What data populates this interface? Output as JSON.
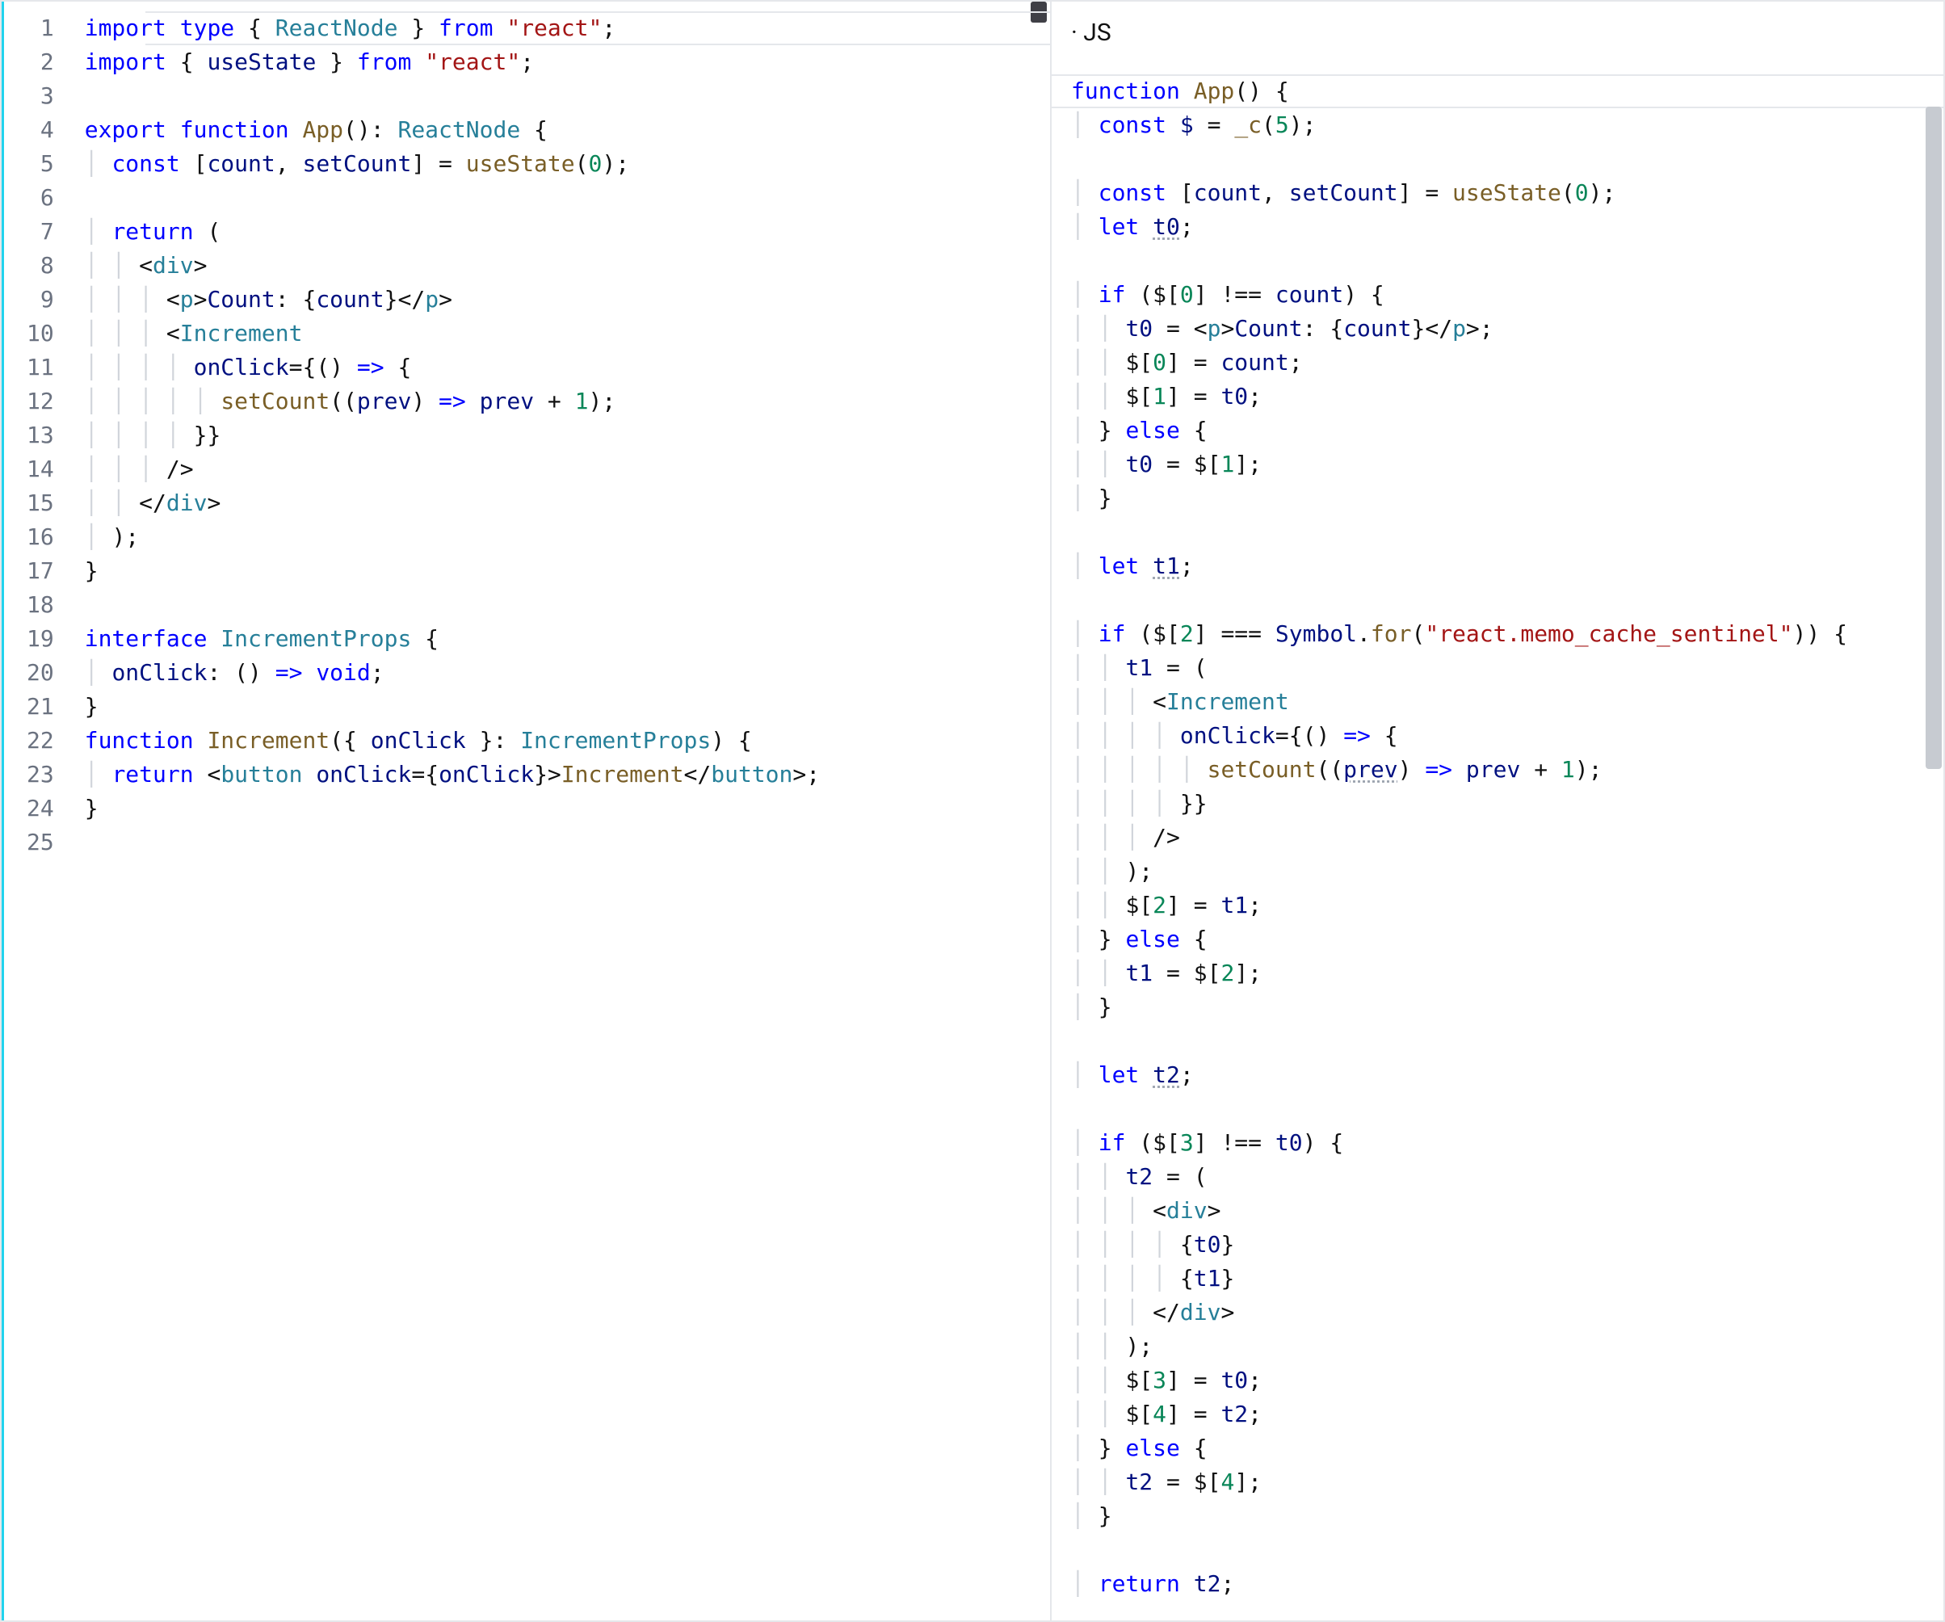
{
  "header": {
    "right_label": "· JS"
  },
  "left": {
    "lineStart": 1,
    "lines": [
      [
        [
          "kw",
          "import"
        ],
        [
          "",
          " "
        ],
        [
          "kw",
          "type"
        ],
        [
          "",
          " { "
        ],
        [
          "type",
          "ReactNode"
        ],
        [
          "",
          " } "
        ],
        [
          "kw",
          "from"
        ],
        [
          "",
          " "
        ],
        [
          "str",
          "\"react\""
        ],
        [
          "",
          ";"
        ]
      ],
      [
        [
          "kw",
          "import"
        ],
        [
          "",
          " { "
        ],
        [
          "var",
          "useState"
        ],
        [
          "",
          " } "
        ],
        [
          "kw",
          "from"
        ],
        [
          "",
          " "
        ],
        [
          "str",
          "\"react\""
        ],
        [
          "",
          ";"
        ]
      ],
      [],
      [
        [
          "kw",
          "export"
        ],
        [
          "",
          " "
        ],
        [
          "kw",
          "function"
        ],
        [
          "",
          " "
        ],
        [
          "fn",
          "App"
        ],
        [
          "",
          "(): "
        ],
        [
          "type",
          "ReactNode"
        ],
        [
          "",
          " {"
        ]
      ],
      [
        [
          "",
          "  "
        ],
        [
          "kw",
          "const"
        ],
        [
          "",
          " ["
        ],
        [
          "var",
          "count"
        ],
        [
          "",
          ", "
        ],
        [
          "var",
          "setCount"
        ],
        [
          "",
          "] = "
        ],
        [
          "fn",
          "useState"
        ],
        [
          "",
          "("
        ],
        [
          "num",
          "0"
        ],
        [
          "",
          ");"
        ]
      ],
      [],
      [
        [
          "",
          "  "
        ],
        [
          "kw",
          "return"
        ],
        [
          "",
          " ("
        ]
      ],
      [
        [
          "",
          "    <"
        ],
        [
          "tag",
          "div"
        ],
        [
          "",
          ">"
        ]
      ],
      [
        [
          "",
          "      <"
        ],
        [
          "tag",
          "p"
        ],
        [
          "",
          ">"
        ],
        [
          "var",
          "Count"
        ],
        [
          "",
          ": {"
        ],
        [
          "var",
          "count"
        ],
        [
          "",
          "}</"
        ],
        [
          "tag",
          "p"
        ],
        [
          "",
          ">"
        ]
      ],
      [
        [
          "",
          "      <"
        ],
        [
          "tag",
          "Increment"
        ]
      ],
      [
        [
          "",
          "        "
        ],
        [
          "var",
          "onClick"
        ],
        [
          "",
          "={() "
        ],
        [
          "kw",
          "=>"
        ],
        [
          "",
          " {"
        ]
      ],
      [
        [
          "",
          "          "
        ],
        [
          "fn",
          "setCount"
        ],
        [
          "",
          "(("
        ],
        [
          "var",
          "prev"
        ],
        [
          "",
          ") "
        ],
        [
          "kw",
          "=>"
        ],
        [
          "",
          " "
        ],
        [
          "var",
          "prev"
        ],
        [
          "",
          " + "
        ],
        [
          "num",
          "1"
        ],
        [
          "",
          ");"
        ]
      ],
      [
        [
          "",
          "        }}"
        ]
      ],
      [
        [
          "",
          "      />"
        ]
      ],
      [
        [
          "",
          "    </"
        ],
        [
          "tag",
          "div"
        ],
        [
          "",
          ">"
        ]
      ],
      [
        [
          "",
          "  );"
        ]
      ],
      [
        [
          "",
          "}"
        ]
      ],
      [],
      [
        [
          "kw",
          "interface"
        ],
        [
          "",
          " "
        ],
        [
          "type",
          "IncrementProps"
        ],
        [
          "",
          " {"
        ]
      ],
      [
        [
          "",
          "  "
        ],
        [
          "var",
          "onClick"
        ],
        [
          "",
          ": () "
        ],
        [
          "kw",
          "=>"
        ],
        [
          "",
          " "
        ],
        [
          "kw",
          "void"
        ],
        [
          "",
          ";"
        ]
      ],
      [
        [
          "",
          "}"
        ]
      ],
      [
        [
          "kw",
          "function"
        ],
        [
          "",
          " "
        ],
        [
          "fn",
          "Increment"
        ],
        [
          "",
          "({ "
        ],
        [
          "var",
          "onClick"
        ],
        [
          "",
          " }: "
        ],
        [
          "type",
          "IncrementProps"
        ],
        [
          "",
          ") {"
        ]
      ],
      [
        [
          "",
          "  "
        ],
        [
          "kw",
          "return"
        ],
        [
          "",
          " <"
        ],
        [
          "tag",
          "button"
        ],
        [
          "",
          " "
        ],
        [
          "var",
          "onClick"
        ],
        [
          "",
          "={"
        ],
        [
          "var",
          "onClick"
        ],
        [
          "",
          "}>"
        ],
        [
          "fn",
          "Increment"
        ],
        [
          "",
          "</"
        ],
        [
          "tag",
          "button"
        ],
        [
          "",
          ">;"
        ]
      ],
      [
        [
          "",
          "}"
        ]
      ],
      []
    ]
  },
  "right": {
    "lines": [
      [
        [
          "kw",
          "function"
        ],
        [
          "",
          " "
        ],
        [
          "fn",
          "App"
        ],
        [
          "",
          "() {"
        ]
      ],
      [
        [
          "",
          "  "
        ],
        [
          "kw",
          "const"
        ],
        [
          "",
          " "
        ],
        [
          "var",
          "$"
        ],
        [
          "",
          " = "
        ],
        [
          "fn",
          "_c"
        ],
        [
          "",
          "("
        ],
        [
          "num",
          "5"
        ],
        [
          "",
          ");"
        ]
      ],
      [],
      [
        [
          "",
          "  "
        ],
        [
          "kw",
          "const"
        ],
        [
          "",
          " ["
        ],
        [
          "var",
          "count"
        ],
        [
          "",
          ", "
        ],
        [
          "var",
          "setCount"
        ],
        [
          "",
          "] = "
        ],
        [
          "fn",
          "useState"
        ],
        [
          "",
          "("
        ],
        [
          "num",
          "0"
        ],
        [
          "",
          ");"
        ]
      ],
      [
        [
          "",
          "  "
        ],
        [
          "kw",
          "let"
        ],
        [
          "",
          " "
        ],
        [
          "var ul",
          "t0"
        ],
        [
          "",
          ";"
        ]
      ],
      [],
      [
        [
          "",
          "  "
        ],
        [
          "kw",
          "if"
        ],
        [
          "",
          " ($["
        ],
        [
          "num",
          "0"
        ],
        [
          "",
          "] !== "
        ],
        [
          "var",
          "count"
        ],
        [
          "",
          ") {"
        ]
      ],
      [
        [
          "",
          "    "
        ],
        [
          "var",
          "t0"
        ],
        [
          "",
          " = <"
        ],
        [
          "tag",
          "p"
        ],
        [
          "",
          ">"
        ],
        [
          "var",
          "Count"
        ],
        [
          "",
          ": {"
        ],
        [
          "var",
          "count"
        ],
        [
          "",
          "}</"
        ],
        [
          "tag",
          "p"
        ],
        [
          "",
          ">;"
        ]
      ],
      [
        [
          "",
          "    $["
        ],
        [
          "num",
          "0"
        ],
        [
          "",
          "] = "
        ],
        [
          "var",
          "count"
        ],
        [
          "",
          ";"
        ]
      ],
      [
        [
          "",
          "    $["
        ],
        [
          "num",
          "1"
        ],
        [
          "",
          "] = "
        ],
        [
          "var",
          "t0"
        ],
        [
          "",
          ";"
        ]
      ],
      [
        [
          "",
          "  } "
        ],
        [
          "kw",
          "else"
        ],
        [
          "",
          " {"
        ]
      ],
      [
        [
          "",
          "    "
        ],
        [
          "var",
          "t0"
        ],
        [
          "",
          " = $["
        ],
        [
          "num",
          "1"
        ],
        [
          "",
          "];"
        ]
      ],
      [
        [
          "",
          "  }"
        ]
      ],
      [],
      [
        [
          "",
          "  "
        ],
        [
          "kw",
          "let"
        ],
        [
          "",
          " "
        ],
        [
          "var ul",
          "t1"
        ],
        [
          "",
          ";"
        ]
      ],
      [],
      [
        [
          "",
          "  "
        ],
        [
          "kw",
          "if"
        ],
        [
          "",
          " ($["
        ],
        [
          "num",
          "2"
        ],
        [
          "",
          "] === "
        ],
        [
          "var",
          "Symbol"
        ],
        [
          "",
          "."
        ],
        [
          "fn",
          "for"
        ],
        [
          "",
          "("
        ],
        [
          "str",
          "\"react.memo_cache_sentinel\""
        ],
        [
          "",
          ")) {"
        ]
      ],
      [
        [
          "",
          "    "
        ],
        [
          "var",
          "t1"
        ],
        [
          "",
          " = ("
        ]
      ],
      [
        [
          "",
          "      <"
        ],
        [
          "tag",
          "Increment"
        ]
      ],
      [
        [
          "",
          "        "
        ],
        [
          "var",
          "onClick"
        ],
        [
          "",
          "={() "
        ],
        [
          "kw",
          "=>"
        ],
        [
          "",
          " {"
        ]
      ],
      [
        [
          "",
          "          "
        ],
        [
          "fn",
          "setCount"
        ],
        [
          "",
          "(("
        ],
        [
          "var ul",
          "prev"
        ],
        [
          "",
          ") "
        ],
        [
          "kw",
          "=>"
        ],
        [
          "",
          " "
        ],
        [
          "var",
          "prev"
        ],
        [
          "",
          " + "
        ],
        [
          "num",
          "1"
        ],
        [
          "",
          ");"
        ]
      ],
      [
        [
          "",
          "        }}"
        ]
      ],
      [
        [
          "",
          "      />"
        ]
      ],
      [
        [
          "",
          "    );"
        ]
      ],
      [
        [
          "",
          "    $["
        ],
        [
          "num",
          "2"
        ],
        [
          "",
          "] = "
        ],
        [
          "var",
          "t1"
        ],
        [
          "",
          ";"
        ]
      ],
      [
        [
          "",
          "  } "
        ],
        [
          "kw",
          "else"
        ],
        [
          "",
          " {"
        ]
      ],
      [
        [
          "",
          "    "
        ],
        [
          "var",
          "t1"
        ],
        [
          "",
          " = $["
        ],
        [
          "num",
          "2"
        ],
        [
          "",
          "];"
        ]
      ],
      [
        [
          "",
          "  }"
        ]
      ],
      [],
      [
        [
          "",
          "  "
        ],
        [
          "kw",
          "let"
        ],
        [
          "",
          " "
        ],
        [
          "var ul",
          "t2"
        ],
        [
          "",
          ";"
        ]
      ],
      [],
      [
        [
          "",
          "  "
        ],
        [
          "kw",
          "if"
        ],
        [
          "",
          " ($["
        ],
        [
          "num",
          "3"
        ],
        [
          "",
          "] !== "
        ],
        [
          "var",
          "t0"
        ],
        [
          "",
          ") {"
        ]
      ],
      [
        [
          "",
          "    "
        ],
        [
          "var",
          "t2"
        ],
        [
          "",
          " = ("
        ]
      ],
      [
        [
          "",
          "      <"
        ],
        [
          "tag",
          "div"
        ],
        [
          "",
          ">"
        ]
      ],
      [
        [
          "",
          "        {"
        ],
        [
          "var",
          "t0"
        ],
        [
          "",
          "}"
        ]
      ],
      [
        [
          "",
          "        {"
        ],
        [
          "var",
          "t1"
        ],
        [
          "",
          "}"
        ]
      ],
      [
        [
          "",
          "      </"
        ],
        [
          "tag",
          "div"
        ],
        [
          "",
          ">"
        ]
      ],
      [
        [
          "",
          "    );"
        ]
      ],
      [
        [
          "",
          "    $["
        ],
        [
          "num",
          "3"
        ],
        [
          "",
          "] = "
        ],
        [
          "var",
          "t0"
        ],
        [
          "",
          ";"
        ]
      ],
      [
        [
          "",
          "    $["
        ],
        [
          "num",
          "4"
        ],
        [
          "",
          "] = "
        ],
        [
          "var",
          "t2"
        ],
        [
          "",
          ";"
        ]
      ],
      [
        [
          "",
          "  } "
        ],
        [
          "kw",
          "else"
        ],
        [
          "",
          " {"
        ]
      ],
      [
        [
          "",
          "    "
        ],
        [
          "var",
          "t2"
        ],
        [
          "",
          " = $["
        ],
        [
          "num",
          "4"
        ],
        [
          "",
          "];"
        ]
      ],
      [
        [
          "",
          "  }"
        ]
      ],
      [],
      [
        [
          "",
          "  "
        ],
        [
          "kw",
          "return"
        ],
        [
          "",
          " "
        ],
        [
          "var",
          "t2"
        ],
        [
          "",
          ";"
        ]
      ]
    ]
  }
}
